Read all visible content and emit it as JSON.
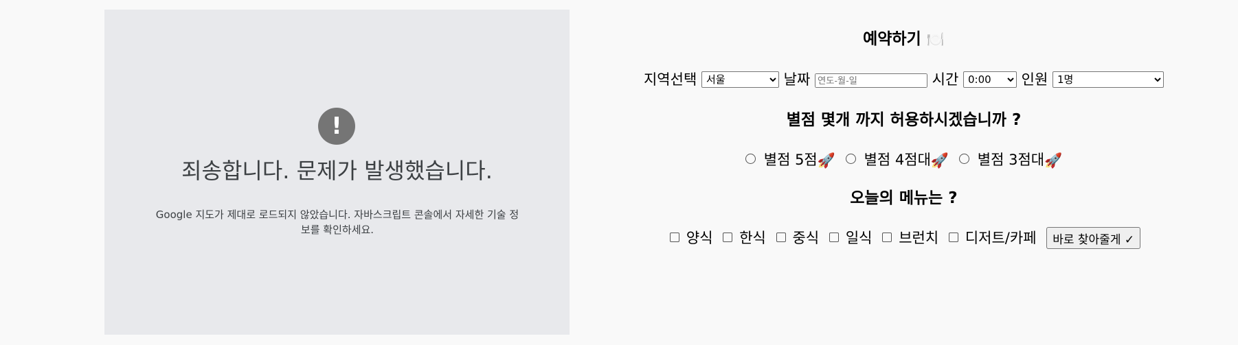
{
  "map_error": {
    "title": "죄송합니다. 문제가 발생했습니다.",
    "description": "Google 지도가 제대로 로드되지 않았습니다. 자바스크립트 콘솔에서 자세한 기술 정보를 확인하세요.",
    "icon": "exclamation-icon",
    "icon_glyph": "!"
  },
  "reservation": {
    "title": "예약하기",
    "title_icon": "🍽️",
    "region_label": "지역선택",
    "region_value": "서울",
    "date_label": "날짜",
    "date_placeholder": "연도-월-일",
    "time_label": "시간",
    "time_value": "0:00",
    "people_label": "인원",
    "people_value": "1명"
  },
  "rating": {
    "question": "별점 몇개 까지 허용하시겠습니까 ?",
    "options": [
      {
        "label": "별점 5점",
        "icon": "🚀"
      },
      {
        "label": "별점 4점대",
        "icon": "🚀"
      },
      {
        "label": "별점 3점대",
        "icon": "🚀"
      }
    ]
  },
  "menu": {
    "question": "오늘의 메뉴는 ?",
    "options": [
      "양식",
      "한식",
      "중식",
      "일식",
      "브런치",
      "디저트/카페"
    ],
    "find_button": "바로 찾아줄게 ✓"
  },
  "colors": {
    "page_bg": "#f9f9f9",
    "map_bg": "#e8e9ec",
    "error_icon_bg": "#757575"
  }
}
